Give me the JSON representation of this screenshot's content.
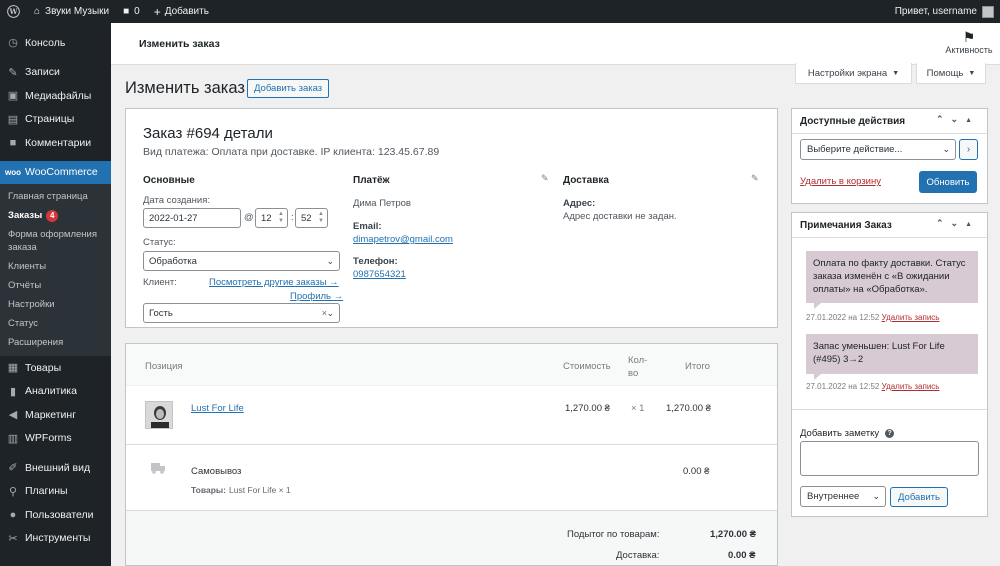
{
  "adminbar": {
    "site_name": "Звуки Музыки",
    "comments_count": "0",
    "new_label": "Добавить",
    "greeting": "Привет, username"
  },
  "sidebar": {
    "items_top": [
      {
        "label": "Консоль",
        "icon": "dashboard-icon"
      },
      {
        "label": "Записи",
        "icon": "pin-icon"
      },
      {
        "label": "Медиафайлы",
        "icon": "media-icon"
      },
      {
        "label": "Страницы",
        "icon": "page-icon"
      },
      {
        "label": "Комментарии",
        "icon": "comment-icon"
      }
    ],
    "woocommerce": {
      "label": "WooCommerce",
      "icon": "woo-icon"
    },
    "submenu": [
      {
        "label": "Главная страница"
      },
      {
        "label": "Заказы",
        "badge": "4"
      },
      {
        "label": "Форма оформления заказа"
      },
      {
        "label": "Клиенты"
      },
      {
        "label": "Отчёты"
      },
      {
        "label": "Настройки"
      },
      {
        "label": "Статус"
      },
      {
        "label": "Расширения"
      }
    ],
    "items_bottom": [
      {
        "label": "Товары",
        "icon": "archive-icon"
      },
      {
        "label": "Аналитика",
        "icon": "chart-icon"
      },
      {
        "label": "Маркетинг",
        "icon": "megaphone-icon"
      },
      {
        "label": "WPForms",
        "icon": "forms-icon"
      },
      {
        "label": "Внешний вид",
        "icon": "brush-icon"
      },
      {
        "label": "Плагины",
        "icon": "plugin-icon"
      },
      {
        "label": "Пользователи",
        "icon": "users-icon"
      },
      {
        "label": "Инструменты",
        "icon": "tools-icon"
      }
    ]
  },
  "header": {
    "title": "Изменить заказ",
    "activity_label": "Активность"
  },
  "screen_options": {
    "label": "Настройки экрана",
    "help": "Помощь"
  },
  "page": {
    "title": "Изменить заказ",
    "add_order": "Добавить заказ"
  },
  "order": {
    "title": "Заказ #694 детали",
    "meta": "Вид платежа: Оплата при доставке. IP клиента: 123.45.67.89",
    "general": {
      "heading": "Основные",
      "date_label": "Дата создания:",
      "date_value": "2022-01-27",
      "at": "@",
      "hour": "12",
      "colon": ":",
      "minute": "52",
      "status_label": "Статус:",
      "status_value": "Обработка",
      "client_label": "Клиент:",
      "other_orders": "Посмотреть другие заказы →",
      "profile": "Профиль →",
      "client_value": "Гость"
    },
    "payment": {
      "heading": "Платёж",
      "name": "Дима Петров",
      "email_label": "Email:",
      "email": "dimapetrov@gmail.com",
      "phone_label": "Телефон:",
      "phone": "0987654321"
    },
    "shipping": {
      "heading": "Доставка",
      "address_label": "Адрес:",
      "address": "Адрес доставки не задан."
    }
  },
  "items": {
    "headers": {
      "item": "Позиция",
      "cost": "Стоимость",
      "qty": "Кол-во",
      "total": "Итого"
    },
    "product": {
      "name": "Lust For Life",
      "cost": "1,270.00 ₴",
      "qty": "× 1",
      "total": "1,270.00 ₴"
    },
    "shipping": {
      "name": "Самовывоз",
      "items_label": "Товары:",
      "items_value": "Lust For Life × 1",
      "total": "0.00 ₴"
    },
    "totals": [
      {
        "label": "Подытог по товарам:",
        "value": "1,270.00 ₴"
      },
      {
        "label": "Доставка:",
        "value": "0.00 ₴"
      }
    ]
  },
  "actions": {
    "title": "Доступные действия",
    "select": "Выберите действие...",
    "go": "›",
    "trash": "Удалить в корзину",
    "update": "Обновить"
  },
  "notes": {
    "title": "Примечания Заказ",
    "list": [
      {
        "text": "Оплата по факту доставки. Статус заказа изменён с «В ожидании оплаты» на «Обработка».",
        "date": "27.01.2022 на 12:52",
        "delete": "Удалить запись"
      },
      {
        "text": "Запас уменьшен: Lust For Life (#495) 3→2",
        "date": "27.01.2022 на 12:52",
        "delete": "Удалить запись"
      }
    ],
    "add_label": "Добавить заметку",
    "type": "Внутреннее",
    "add_button": "Добавить"
  },
  "colors": {
    "accent": "#2271b1",
    "sidebar": "#1d2327",
    "note_bg": "#d7cad2",
    "danger": "#b32d2e"
  }
}
